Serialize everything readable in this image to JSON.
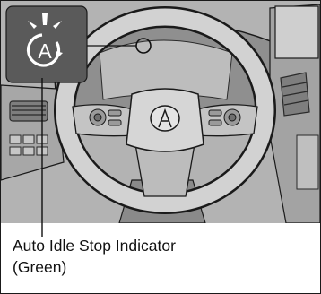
{
  "callout": {
    "line1": "Auto Idle Stop Indicator",
    "line2": "(Green)"
  },
  "indicator_icon": "auto-idle-stop-icon",
  "indicator_letter": "A",
  "colors": {
    "scene_background": "#b3b3b3",
    "callout_box": "#5a5a5a",
    "callout_symbol": "#ffffff",
    "leader_line": "#111111",
    "outline": "#1a1a1a"
  }
}
